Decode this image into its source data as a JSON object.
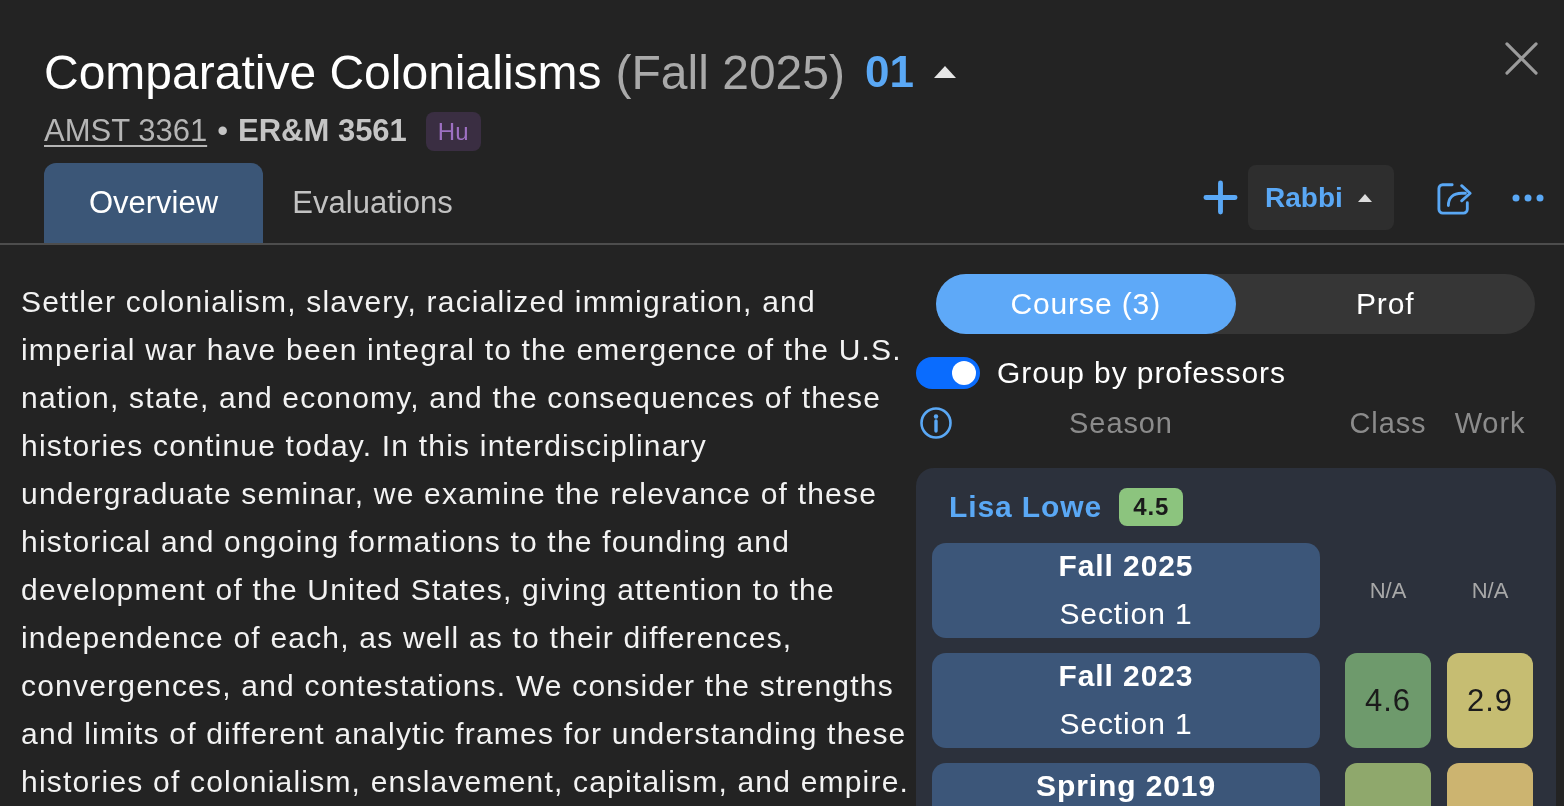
{
  "header": {
    "title": "Comparative Colonialisms",
    "term": "(Fall 2025)",
    "section": "01"
  },
  "listings": [
    {
      "code": "AMST 3361",
      "kind": "link"
    },
    {
      "code": "ER&M 3561",
      "kind": "current"
    }
  ],
  "separator": "•",
  "areas": [
    {
      "label": "Hu"
    }
  ],
  "tabs": [
    {
      "label": "Overview",
      "selected": true
    },
    {
      "label": "Evaluations",
      "selected": false
    }
  ],
  "toolbar": {
    "worksheet": "Rabbi"
  },
  "description": "Settler colonialism, slavery, racialized immigration, and imperial war have been integral to the emergence of the U.S. nation, state, and economy, and the consequences of these histories continue today. In this interdisciplinary undergraduate seminar, we examine the relevance of these historical and ongoing formations to the founding and development of the United States, giving attention to the independence of each, as well as to their differences, convergences, and contestations. We consider the strengths and limits of different analytic frames for understanding these histories of colonialism, enslavement, capitalism, and empire.",
  "evaluations": {
    "segments": [
      {
        "label": "Course (3)",
        "selected": true
      },
      {
        "label": "Prof",
        "selected": false
      }
    ],
    "group_toggle": {
      "label": "Group by professors",
      "on": true
    },
    "columns": [
      "Season",
      "Class",
      "Work"
    ],
    "groups": [
      {
        "professor": "Lisa Lowe",
        "rating": {
          "value": "4.5",
          "color": "#8cc47e"
        },
        "rows": [
          {
            "season": "Fall 2025",
            "section": "Section 1",
            "class": {
              "value": "N/A"
            },
            "work": {
              "value": "N/A"
            }
          },
          {
            "season": "Fall 2023",
            "section": "Section 1",
            "class": {
              "value": "4.6",
              "color": "#6e9a6c"
            },
            "work": {
              "value": "2.9",
              "color": "#c6bd72"
            }
          },
          {
            "season": "Spring 2019",
            "class": {
              "color": "#8fa86c"
            },
            "work": {
              "color": "#ccb470"
            }
          }
        ]
      }
    ]
  }
}
